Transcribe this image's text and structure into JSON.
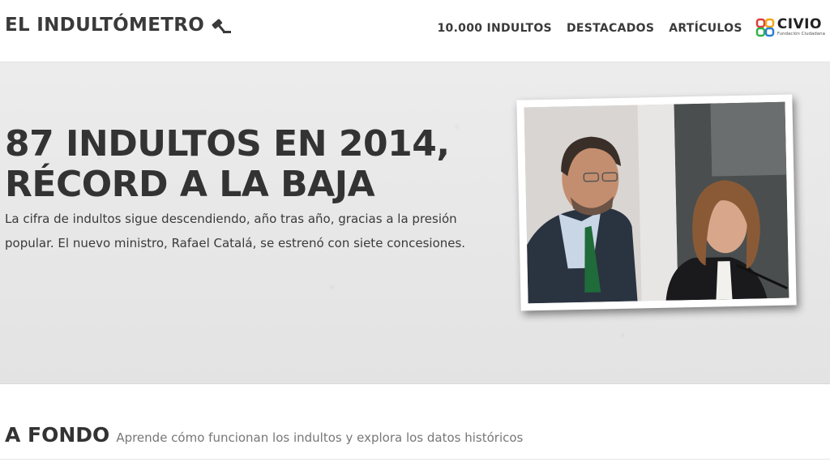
{
  "site": {
    "title": "EL INDULTÓMETRO",
    "icon": "gavel-icon"
  },
  "nav": {
    "items": [
      {
        "label": "10.000 INDULTOS"
      },
      {
        "label": "DESTACADOS"
      },
      {
        "label": "ARTÍCULOS"
      }
    ],
    "partner": {
      "name": "CIVIO",
      "subtitle": "Fundación Ciudadana"
    }
  },
  "hero": {
    "headline_line1": "87 INDULTOS EN 2014,",
    "headline_line2": "RÉCORD A LA BAJA",
    "dek": "La cifra de indultos sigue descendiendo, año tras año, gracias a la presión popular. El nuevo ministro, Rafael Catalá, se estrenó con siete concesiones."
  },
  "section": {
    "title": "A FONDO",
    "subtitle": "Aprende cómo funcionan los indultos y explora los datos históricos"
  },
  "colors": {
    "text": "#333333",
    "hero_bg": "#e6e6e6",
    "header_bg": "#ffffff"
  }
}
